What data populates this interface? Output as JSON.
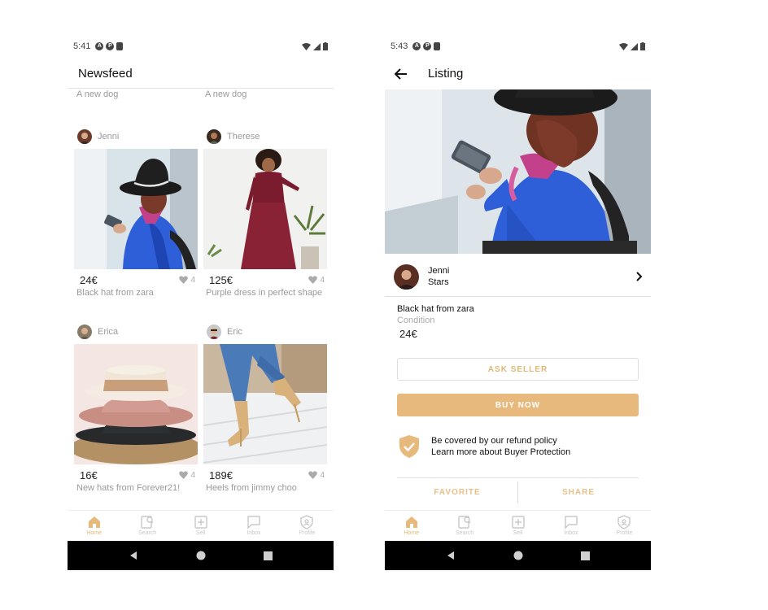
{
  "left_screen": {
    "status": {
      "time": "5:41"
    },
    "title": "Newsfeed",
    "prev_row": [
      "A new dog",
      "A new dog"
    ],
    "posts": [
      {
        "user": "Jenni",
        "price": "24€",
        "likes": "4",
        "title": "Black hat from zara"
      },
      {
        "user": "Therese",
        "price": "125€",
        "likes": "4",
        "title": "Purple dress in perfect shape"
      },
      {
        "user": "Erica",
        "price": "16€",
        "likes": "4",
        "title": "New hats from Forever21!"
      },
      {
        "user": "Eric",
        "price": "189€",
        "likes": "4",
        "title": "Heels from jimmy choo"
      }
    ]
  },
  "right_screen": {
    "status": {
      "time": "5:43"
    },
    "title": "Listing",
    "seller": {
      "name": "Jenni",
      "subtitle": "Stars"
    },
    "item": {
      "title": "Black hat from zara",
      "condition_label": "Condition",
      "price": "24€"
    },
    "buttons": {
      "ask": "ASK SELLER",
      "buy": "BUY NOW",
      "favorite": "FAVORITE",
      "share": "SHARE"
    },
    "protection": {
      "line1": "Be covered by our refund policy",
      "line2": "Learn more about Buyer Protection"
    }
  },
  "bottom_nav": {
    "items": [
      {
        "label": "Home",
        "icon": "home-icon"
      },
      {
        "label": "Search",
        "icon": "search-icon"
      },
      {
        "label": "Sell",
        "icon": "sell-icon"
      },
      {
        "label": "Inbox",
        "icon": "inbox-icon"
      },
      {
        "label": "Profile",
        "icon": "profile-icon"
      }
    ]
  },
  "colors": {
    "accent": "#e8b97d",
    "inactive": "#c8c8c8"
  }
}
